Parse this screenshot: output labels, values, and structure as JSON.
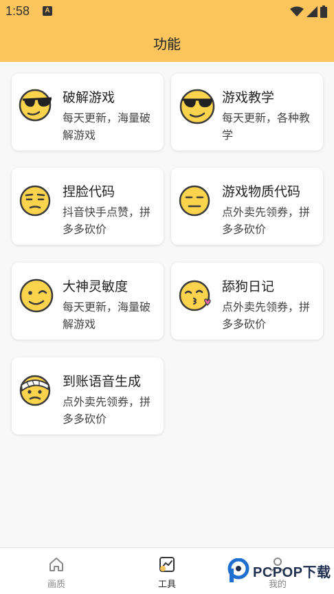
{
  "status_bar": {
    "time": "1:58",
    "notification_icon": "A"
  },
  "header": {
    "title": "功能"
  },
  "cards": [
    {
      "title": "破解游戏",
      "desc": "每天更新，海量破解游戏",
      "icon": "sunglasses-face-icon"
    },
    {
      "title": "游戏教学",
      "desc": "每天更新，各种教学",
      "icon": "sunglasses-face-icon"
    },
    {
      "title": "捏脸代码",
      "desc": "抖音快手点赞，拼多多砍价",
      "icon": "unamused-face-icon"
    },
    {
      "title": "游戏物质代码",
      "desc": "点外卖先领券，拼多多砍价",
      "icon": "expressionless-face-icon"
    },
    {
      "title": "大神灵敏度",
      "desc": "每天更新，海量破解游戏",
      "icon": "winking-face-icon"
    },
    {
      "title": "舔狗日记",
      "desc": "点外卖先领券，拼多多砍价",
      "icon": "kissing-face-icon"
    },
    {
      "title": "到账语音生成",
      "desc": "点外卖先领券，拼多多砍价",
      "icon": "bandaged-face-icon"
    }
  ],
  "bottom_nav": {
    "items": [
      {
        "label": "画质",
        "icon": "home-icon",
        "active": false
      },
      {
        "label": "工具",
        "icon": "tools-icon",
        "active": true
      },
      {
        "label": "我的",
        "icon": "person-icon",
        "active": false
      }
    ]
  },
  "watermark": {
    "text": "PCPOP下载"
  },
  "colors": {
    "accent": "#fbc45c",
    "face": "#fbd34d",
    "face_outline": "#3a3a3a"
  }
}
